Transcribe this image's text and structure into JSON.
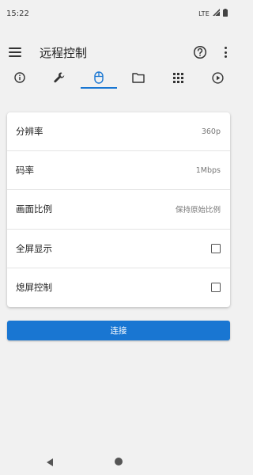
{
  "status_bar": {
    "time": "15:22",
    "network": "LTE"
  },
  "app_bar": {
    "title": "远程控制"
  },
  "tabs": [
    {
      "icon": "info-icon"
    },
    {
      "icon": "wrench-icon"
    },
    {
      "icon": "mouse-icon",
      "active": true
    },
    {
      "icon": "folder-icon"
    },
    {
      "icon": "apps-grid-icon"
    },
    {
      "icon": "play-circle-icon"
    }
  ],
  "settings": {
    "resolution": {
      "label": "分辨率",
      "value": "360p"
    },
    "bitrate": {
      "label": "码率",
      "value": "1Mbps"
    },
    "aspect_ratio": {
      "label": "画面比例",
      "value": "保持原始比例"
    },
    "fullscreen": {
      "label": "全屏显示",
      "checked": false
    },
    "screen_off": {
      "label": "熄屏控制",
      "checked": false
    }
  },
  "connect_button": {
    "label": "连接"
  },
  "colors": {
    "accent": "#1976d2",
    "background": "#f1f1f1",
    "card": "#ffffff"
  }
}
